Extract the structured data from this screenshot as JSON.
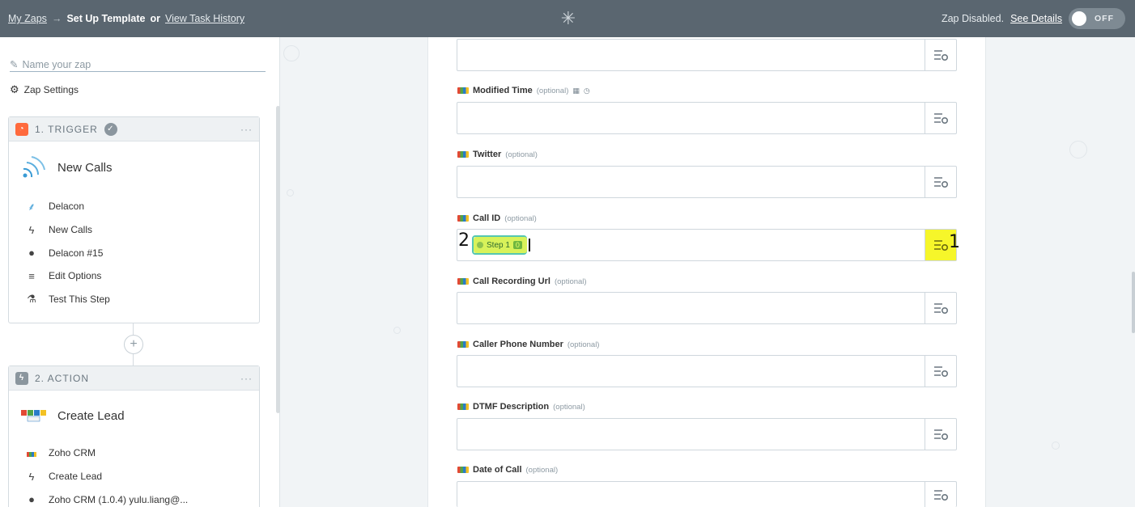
{
  "topbar": {
    "breadcrumb": {
      "my_zaps": "My Zaps",
      "arrow": "→",
      "current": "Set Up Template",
      "or": "or",
      "task_history": "View Task History"
    },
    "logo_icon": "zapier-asterisk-icon",
    "status_text": "Zap Disabled.",
    "see_details": "See Details",
    "toggle_label": "OFF"
  },
  "sidebar": {
    "zap_name_placeholder": "Name your zap",
    "settings_label": "Zap Settings",
    "trigger": {
      "step_label": "1. TRIGGER",
      "menu": "···",
      "app_title": "New Calls",
      "items": [
        {
          "label": "Delacon",
          "icon": "delacon-icon"
        },
        {
          "label": "New Calls",
          "icon": "bolt-icon"
        },
        {
          "label": "Delacon #15",
          "icon": "user-icon"
        },
        {
          "label": "Edit Options",
          "icon": "menu-lines-icon"
        },
        {
          "label": "Test This Step",
          "icon": "flask-icon"
        }
      ]
    },
    "action": {
      "step_label": "2. ACTION",
      "menu": "···",
      "app_title": "Create Lead",
      "items": [
        {
          "label": "Zoho CRM",
          "icon": "zoho-icon"
        },
        {
          "label": "Create Lead",
          "icon": "bolt-icon"
        },
        {
          "label": "Zoho CRM (1.0.4) yulu.liang@...",
          "icon": "user-icon"
        }
      ]
    }
  },
  "fields": [
    {
      "label": "Modified Time",
      "optional": "(optional)"
    },
    {
      "label": "Twitter",
      "optional": "(optional)"
    },
    {
      "label": "Call ID",
      "optional": "(optional)"
    },
    {
      "label": "Call Recording Url",
      "optional": "(optional)"
    },
    {
      "label": "Caller Phone Number",
      "optional": "(optional)"
    },
    {
      "label": "DTMF Description",
      "optional": "(optional)"
    },
    {
      "label": "Date of Call",
      "optional": "(optional)"
    }
  ],
  "call_id_pill": {
    "step": "Step 1",
    "value": "0"
  },
  "annotations": {
    "one": "1",
    "two": "2"
  },
  "colors": {
    "topbar": "#5a6670",
    "highlight": "#f6f62a",
    "pill": "#d8f25a",
    "trigger_badge": "#ff6a3d",
    "action_badge": "#8b969e"
  }
}
